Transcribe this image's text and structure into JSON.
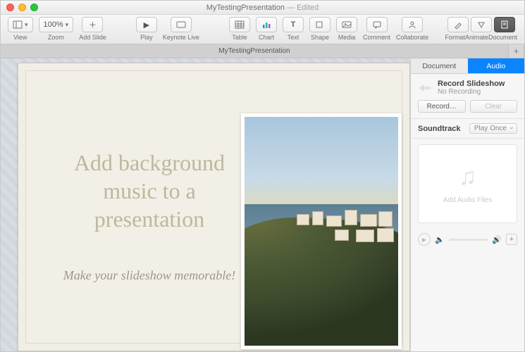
{
  "window": {
    "doc_name": "MyTestingPresentation",
    "edited_suffix": " — Edited"
  },
  "toolbar": {
    "view": "View",
    "zoom_value": "100%",
    "zoom": "Zoom",
    "add_slide": "Add Slide",
    "play": "Play",
    "keynote_live": "Keynote Live",
    "table": "Table",
    "chart": "Chart",
    "text": "Text",
    "shape": "Shape",
    "media": "Media",
    "comment": "Comment",
    "collaborate": "Collaborate",
    "format": "Format",
    "animate": "Animate",
    "document": "Document"
  },
  "tabbar": {
    "tab1": "MyTestingPresentation",
    "add": "+"
  },
  "slide": {
    "title": "Add background music to a presentation",
    "subtitle": "Make your slideshow memorable!"
  },
  "inspector": {
    "tab_document": "Document",
    "tab_audio": "Audio",
    "record_title": "Record Slideshow",
    "record_status": "No Recording",
    "record_btn": "Record…",
    "clear_btn": "Clear",
    "soundtrack_label": "Soundtrack",
    "play_mode": "Play Once",
    "dropzone_label": "Add Audio Files",
    "play_glyph": "▶",
    "speaker_low": "🔈",
    "speaker_hi": "🔊",
    "plus": "+"
  }
}
